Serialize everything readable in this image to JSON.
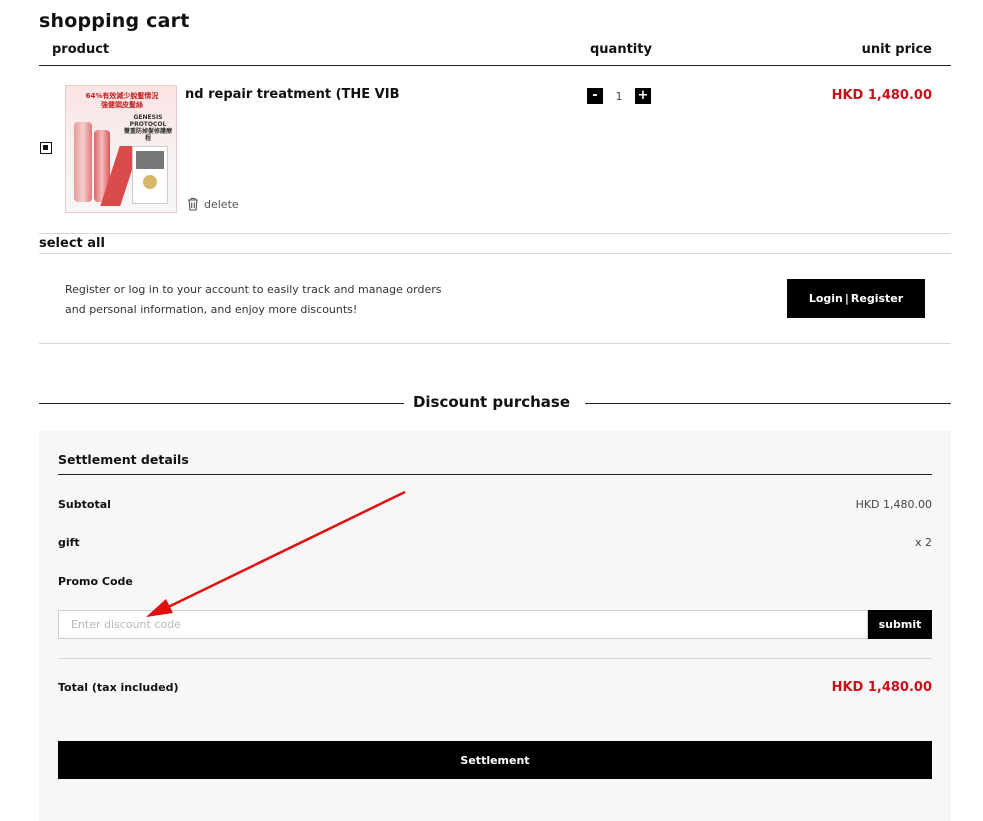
{
  "cart": {
    "title": "shopping cart",
    "columns": {
      "product": "product",
      "quantity": "quantity",
      "unit_price": "unit price"
    },
    "item": {
      "image_lines": [
        "64%有效減少脫髮情況",
        "強健頭皮髮絲"
      ],
      "image_badge": "GENESIS PROTOCOL",
      "image_caption": "雙重防掉髮修護療程",
      "name": "nd repair treatment (THE VIB",
      "delete_label": "delete",
      "quantity": "1",
      "minus": "-",
      "plus": "+",
      "price": "HKD 1,480.00",
      "selected": true
    },
    "select_all": "select all"
  },
  "register": {
    "text": "Register or log in to your account to easily track and manage orders and personal information, and enjoy more discounts!",
    "login": "Login",
    "separator": "|",
    "register": "Register"
  },
  "discount": {
    "title": "Discount purchase"
  },
  "settlement": {
    "heading": "Settlement details",
    "subtotal_label": "Subtotal",
    "subtotal_value": "HKD 1,480.00",
    "gift_label": "gift",
    "gift_value": "x 2",
    "promo_label": "Promo Code",
    "promo_placeholder": "Enter discount code",
    "promo_value": "",
    "submit": "submit",
    "total_label": "Total (tax included)",
    "total_value": "HKD 1,480.00",
    "settle_button": "Settlement"
  },
  "colors": {
    "accent_red": "#c8101c",
    "button_bg": "#000000",
    "panel_bg": "#f7f7f7",
    "arrow": "#e01010"
  }
}
